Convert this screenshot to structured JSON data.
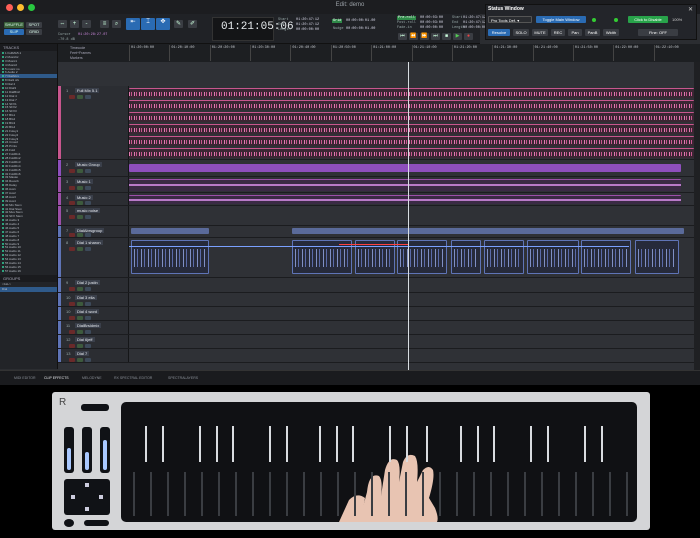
{
  "window": {
    "title": "Edit: demo"
  },
  "toolbar": {
    "mode_labels": [
      "SHUFFLE",
      "SPOT",
      "SLIP",
      "GRID"
    ],
    "main_counter": "01:21:05:06",
    "counter_arrow": "▾",
    "counter_labels": [
      "Start",
      "End",
      "Length"
    ],
    "counter_values": [
      "01:20:47:12",
      "01:20:47:12",
      "00:00:00:00"
    ],
    "nudge_label": "Nudge",
    "grid_label": "Grid",
    "grid_value": "00:00:00:01.00",
    "nudge_value": "00:00:00:01.00",
    "cursor_label": "Cursor",
    "cursor_value": "01:20:28:27.07",
    "db_value": "-70.8 dB",
    "pre_post": [
      "Pre-roll",
      "Post-roll",
      "Fade-in"
    ],
    "transport_counts": [
      "00:00:03:00",
      "00:00:03:00",
      "00:00:00:00"
    ],
    "tempo": "120.0000",
    "meter": "4/4",
    "sel_labels": [
      "Start",
      "End",
      "Length"
    ],
    "sel_values": [
      "01:20:47:12",
      "01:20:47:12",
      "00:00:00:00"
    ]
  },
  "status_window": {
    "title": "Status Window",
    "preset": "Pro Tools Def.",
    "preset_arrow": "▾",
    "toggle_main": "Toggle Main Window",
    "click_disable": "Click to Disable",
    "pct": "100%",
    "buttons": [
      "Resolve",
      "SOLO",
      "MUTE",
      "REC",
      "Pan",
      "PanB",
      "Width",
      "Fine: OFF"
    ]
  },
  "ruler_labels": [
    "Timecode",
    "Feet+Frames",
    "Markers"
  ],
  "timecodes": [
    "01:20:00:00",
    "01:20:10:00",
    "01:20:20:00",
    "01:20:30:00",
    "01:20:40:00",
    "01:20:50:00",
    "01:21:00:00",
    "01:21:10:00",
    "01:21:20:00",
    "01:21:30:00",
    "01:21:40:00",
    "01:21:50:00",
    "01:22:00:00",
    "01:22:10:00"
  ],
  "tracks_panel": {
    "header": "TRACKS",
    "groups_header": "GROUPS",
    "groups": [
      "<ALL>",
      "Dial"
    ],
    "items": [
      "1 FullMix5.1",
      "2 MusicGr",
      "3 Music1",
      "4 Music2",
      "5 music no",
      "6 Audio 2",
      "7 DialAbrs",
      "8 Dial1 shr",
      "9 Dial 2",
      "10 Dial3",
      "11 DialBrsh",
      "12 Dial 4",
      "13 Dial 7",
      "14 SFX1",
      "15 SFX2",
      "16 SFX3",
      "17 BG1",
      "18 BG2",
      "19 BG3",
      "20 BG4",
      "21 Foley1",
      "22 Foley2",
      "23 Foley3",
      "24 Crowd",
      "25 Prints",
      "26 Fold",
      "27 FoldDn1",
      "28 FoldDn2",
      "29 FoldDn3",
      "30 FoldDn4",
      "31 FoldDn5",
      "32 FoldDn6",
      "33 Master",
      "34 Reverb",
      "35 Delay",
      "36 Aux1",
      "37 Aux2",
      "38 Aux3",
      "39 Aux4",
      "40 Mix Stem",
      "41 Dial Stem",
      "42 Mus Stem",
      "43 SFX Stem",
      "44 Audio 3",
      "45 Audio 4",
      "46 Audio 5",
      "47 Audio 6",
      "48 Audio 7",
      "49 Audio 8",
      "50 Audio 9",
      "51 Audio 10",
      "52 Audio 11",
      "53 Audio 12",
      "54 Audio 13",
      "55 Audio 14",
      "56 Audio 15",
      "57 Audio 16"
    ]
  },
  "tracks": [
    {
      "num": "1",
      "name": "Full Mix 5.1",
      "color": "#c8568e"
    },
    {
      "num": "2",
      "name": "Music Group",
      "color": "#8e4fbd"
    },
    {
      "num": "3",
      "name": "Music 1",
      "color": "#9c4fa8"
    },
    {
      "num": "4",
      "name": "Music 2",
      "color": "#9c4fa8"
    },
    {
      "num": "5",
      "name": "music noise",
      "color": "#9c4fa8"
    },
    {
      "num": "7",
      "name": "DialAbrsgroup",
      "color": "#5f74b6"
    },
    {
      "num": "8",
      "name": "Dial 1 sharon",
      "color": "#5f74b6"
    },
    {
      "num": "9",
      "name": "Dial 2 justin",
      "color": "#5f74b6"
    },
    {
      "num": "10",
      "name": "Dial 3 ella",
      "color": "#5f74b6"
    },
    {
      "num": "10",
      "name": "Dial 4 word",
      "color": "#5f74b6"
    },
    {
      "num": "11",
      "name": "DialBrsldmix",
      "color": "#5f74b6"
    },
    {
      "num": "12",
      "name": "Dial 6jeff",
      "color": "#5f74b6"
    },
    {
      "num": "13",
      "name": "Dial 7",
      "color": "#5f74b6"
    }
  ],
  "bottom_tabs": [
    "MIDI EDITOR",
    "CLIP EFFECTS",
    "MELODYNE",
    "RX SPECTRAL EDITOR",
    "SPECTRALAYERS"
  ],
  "hardware": {
    "logo": "R"
  }
}
